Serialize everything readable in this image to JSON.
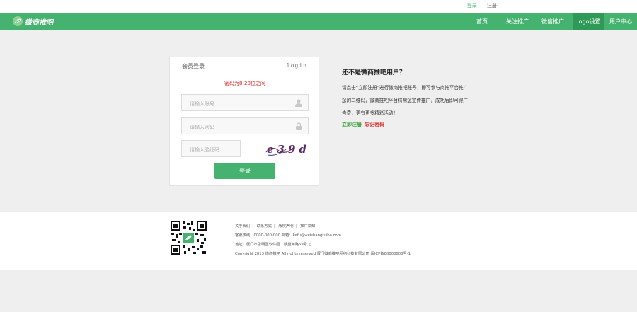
{
  "topbar": {
    "login": "登录",
    "register": "注册"
  },
  "brand": {
    "name": "微商推吧"
  },
  "nav": {
    "items": [
      {
        "label": "首页"
      },
      {
        "label": "关注推广"
      },
      {
        "label": "微信推广"
      },
      {
        "label": "logo设置"
      },
      {
        "label": "用户中心"
      }
    ]
  },
  "login": {
    "title": "会员登录",
    "title_en": "login",
    "error": "密码为8-20位之间",
    "username_placeholder": "请输入账号",
    "password_placeholder": "请输入密码",
    "code_placeholder": "请输入验证码",
    "captcha_text": "e39d",
    "submit": "登录"
  },
  "info": {
    "title": "还不是微商推吧用户？",
    "text": "请点击“立即注册”进行微商推吧账号，即可参与商推平台推广您的二维码，微商推吧平台将帮您宣传推广，成功后即可得广告费，更有更多精彩活动！",
    "register_link": "立即注册",
    "forgot_link": "忘记密码"
  },
  "footer": {
    "links": [
      "关于我们",
      "联系方式",
      "版权声明",
      "推广须知"
    ],
    "contact": "客服热线：0000-000-000  邮箱：kefu@weishangtuiba.com",
    "address": "地址：厦门市思明区软件园二期望海路59号之二",
    "copyright": "Copyright 2013 微商推吧 All rights reserved  厦门微商推吧网络科技有限公司 闽ICP备00000000号-1"
  },
  "colors": {
    "brand_green": "#45b36f",
    "active_nav": "#2f9a58",
    "error_red": "#dd2222"
  }
}
